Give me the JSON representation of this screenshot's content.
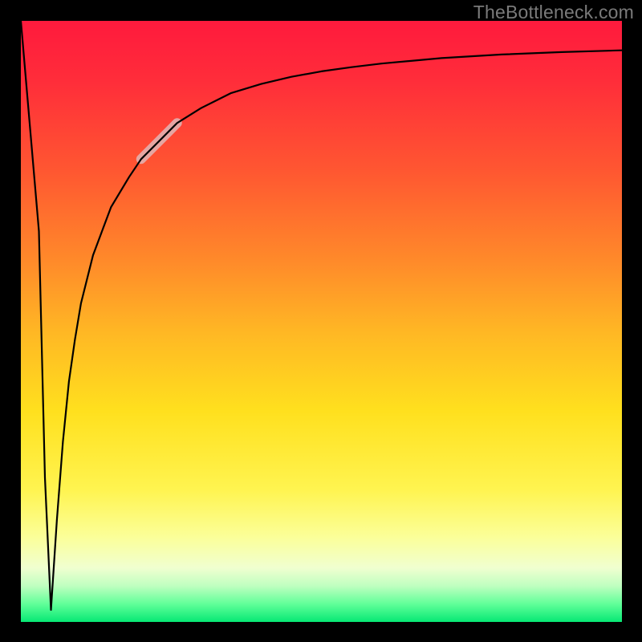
{
  "watermark": "TheBottleneck.com",
  "colors": {
    "frame": "#000000",
    "curve": "#000000",
    "highlight": "rgba(224,182,182,0.85)",
    "gradient_stops": [
      "#ff1a3d",
      "#ff2d3a",
      "#ff5731",
      "#ff8a2a",
      "#ffb824",
      "#ffe01e",
      "#fff450",
      "#fbff9a",
      "#f0ffd0",
      "#bfffc0",
      "#61ff99",
      "#07e874"
    ]
  },
  "chart_data": {
    "type": "line",
    "title": "",
    "xlabel": "",
    "ylabel": "",
    "xlim": [
      0,
      100
    ],
    "ylim": [
      0,
      100
    ],
    "x": [
      0,
      3,
      4,
      5,
      6,
      7,
      8,
      9,
      10,
      12,
      15,
      18,
      20,
      23,
      26,
      30,
      35,
      40,
      45,
      50,
      55,
      60,
      70,
      80,
      90,
      100
    ],
    "values": [
      100,
      65,
      24,
      2,
      17,
      30,
      40,
      47,
      53,
      61,
      69,
      74,
      77,
      80,
      83,
      85.5,
      88,
      89.5,
      90.7,
      91.6,
      92.3,
      92.9,
      93.8,
      94.4,
      94.8,
      95.1
    ],
    "highlight_segment": {
      "x_start": 20,
      "x_end": 26
    },
    "notes": "Background gradient encodes a qualitative good→bad scale from bottom (green) to top (red). The curve plunges sharply near x≈5 (notch to y≈2) then rises asymptotically toward ~95. A pale pink thick stroke highlights the segment roughly over x 20–26."
  }
}
